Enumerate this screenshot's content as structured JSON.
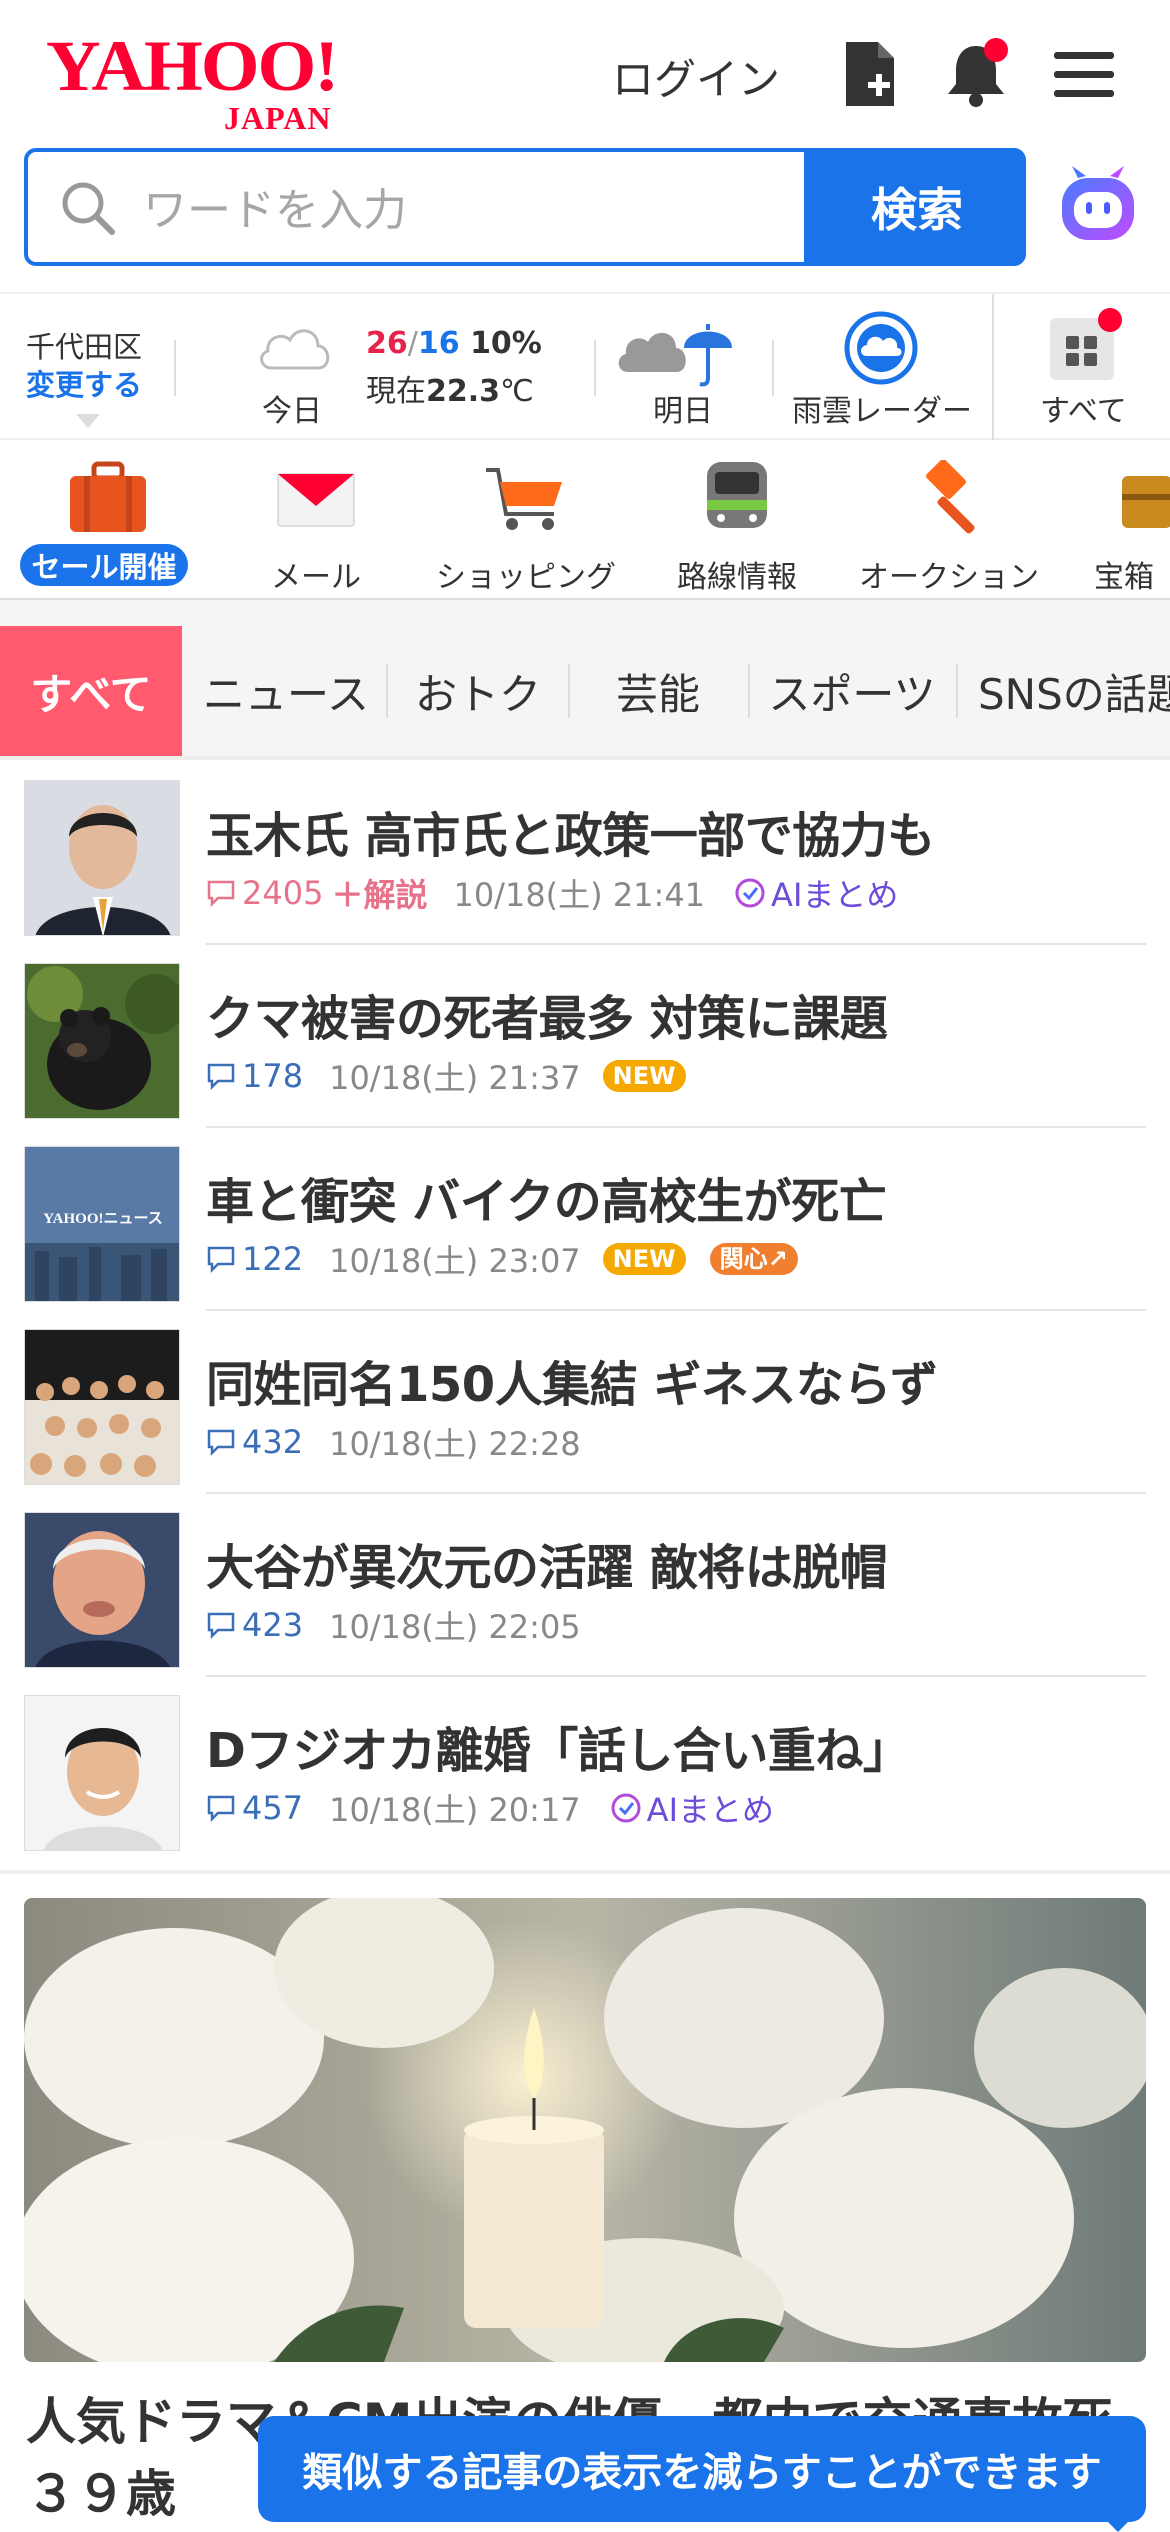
{
  "header": {
    "logo_main": "YAHOO!",
    "logo_sub": "JAPAN",
    "login_label": "ログイン"
  },
  "search": {
    "placeholder": "ワードを入力",
    "button_label": "検索"
  },
  "weather": {
    "area": "千代田区",
    "change_label": "変更する",
    "today_label": "今日",
    "high": "26",
    "slash": "/",
    "low": "16",
    "rain_chance": "10%",
    "current_prefix": "現在",
    "current_temp": "22.3",
    "current_unit": "℃",
    "tomorrow_label": "明日",
    "radar_label": "雨雲レーダー",
    "all_label": "すべて"
  },
  "services": [
    {
      "label": "メール",
      "icon": "mail-icon"
    },
    {
      "label": "ショッピング",
      "icon": "shopping-cart-icon"
    },
    {
      "label": "路線情報",
      "icon": "train-icon"
    },
    {
      "label": "オークション",
      "icon": "auction-hammer-icon"
    },
    {
      "label": "宝箱",
      "icon": "treasure-box-icon"
    }
  ],
  "sale_badge": "セール開催",
  "tabs": [
    "すべて",
    "ニュース",
    "おトク",
    "芸能",
    "スポーツ",
    "SNSの話題"
  ],
  "news": [
    {
      "title": "玉木氏 高市氏と政策一部で協力も",
      "comments": "2405",
      "plus": "＋解説",
      "time": "10/18(土) 21:41",
      "ai": "AIまとめ"
    },
    {
      "title": "クマ被害の死者最多 対策に課題",
      "comments": "178",
      "time": "10/18(土) 21:37",
      "badge_new": "NEW"
    },
    {
      "title": "車と衝突 バイクの高校生が死亡",
      "comments": "122",
      "time": "10/18(土) 23:07",
      "badge_new": "NEW",
      "badge_kanshin": "関心"
    },
    {
      "title": "同姓同名150人集結 ギネスならず",
      "comments": "432",
      "time": "10/18(土) 22:28"
    },
    {
      "title": "大谷が異次元の活躍 敵将は脱帽",
      "comments": "423",
      "time": "10/18(土) 22:05"
    },
    {
      "title": "Dフジオカ離婚「話し合い重ね」",
      "comments": "457",
      "time": "10/18(土) 20:17",
      "ai": "AIまとめ"
    }
  ],
  "thumb3_text": "YAHOO!ニュース",
  "feature": {
    "title": "人気ドラマ＆CM出演の俳優　都内で交通事故死　３９歳"
  },
  "toast": "類似する記事の表示を減らすことができます",
  "colors": {
    "brand_red": "#ff0033",
    "accent_blue": "#1a73e8",
    "tab_active": "#ff5a6e",
    "new_badge": "#f5a800"
  }
}
